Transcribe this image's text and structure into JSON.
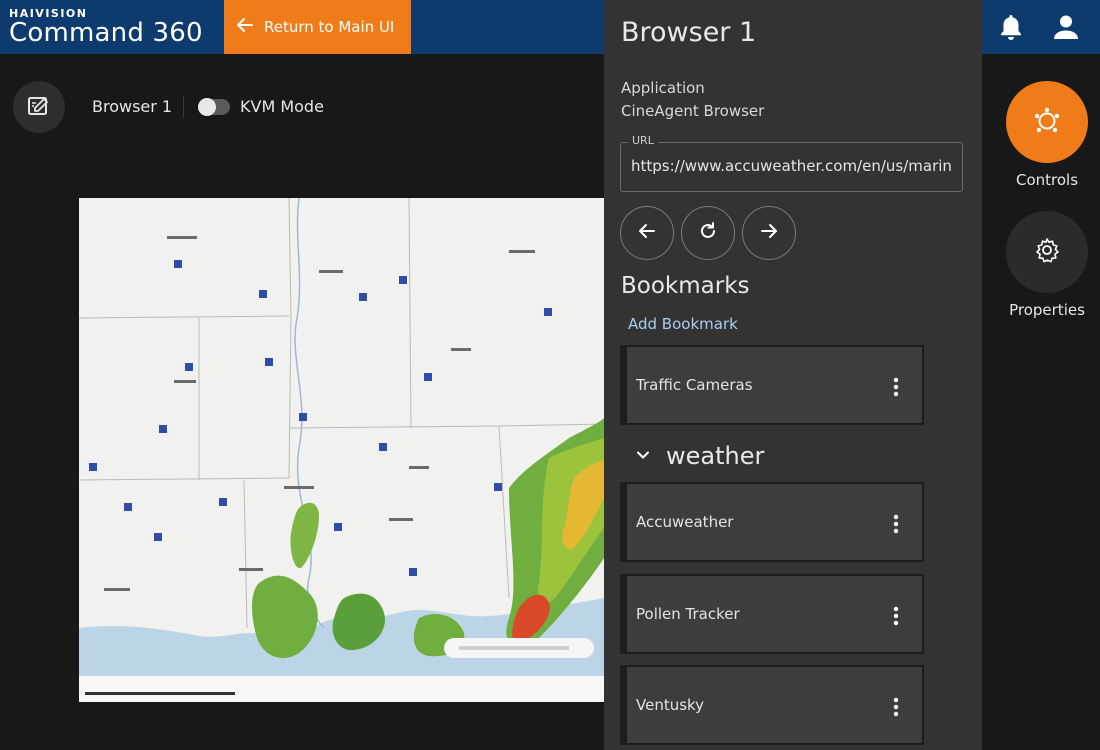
{
  "header": {
    "brand": "HAIVISION",
    "product": "Command 360",
    "return_label": "Return to Main UI",
    "notification_icon": "bell-icon",
    "user_icon": "user-icon"
  },
  "toolbar": {
    "source_title": "Browser 1",
    "kvm_label": "KVM Mode",
    "kvm_enabled": false
  },
  "panel": {
    "title": "Browser 1",
    "application_label": "Application",
    "application_value": "CineAgent Browser",
    "url_label": "URL",
    "url_value": "https://www.accuweather.com/en/us/marine-radar",
    "bookmarks_title": "Bookmarks",
    "add_bookmark_label": "Add Bookmark",
    "bookmarks": [
      {
        "label": "Traffic Cameras"
      }
    ],
    "group": {
      "name": "weather",
      "expanded": true,
      "bookmarks": [
        {
          "label": "Accuweather"
        },
        {
          "label": "Pollen Tracker"
        },
        {
          "label": "Ventusky"
        }
      ]
    }
  },
  "rail": {
    "controls_label": "Controls",
    "properties_label": "Properties"
  },
  "colors": {
    "header_bg": "#0d3b6e",
    "accent": "#f07c19",
    "panel_bg": "#333333",
    "link": "#a9cdf0"
  }
}
